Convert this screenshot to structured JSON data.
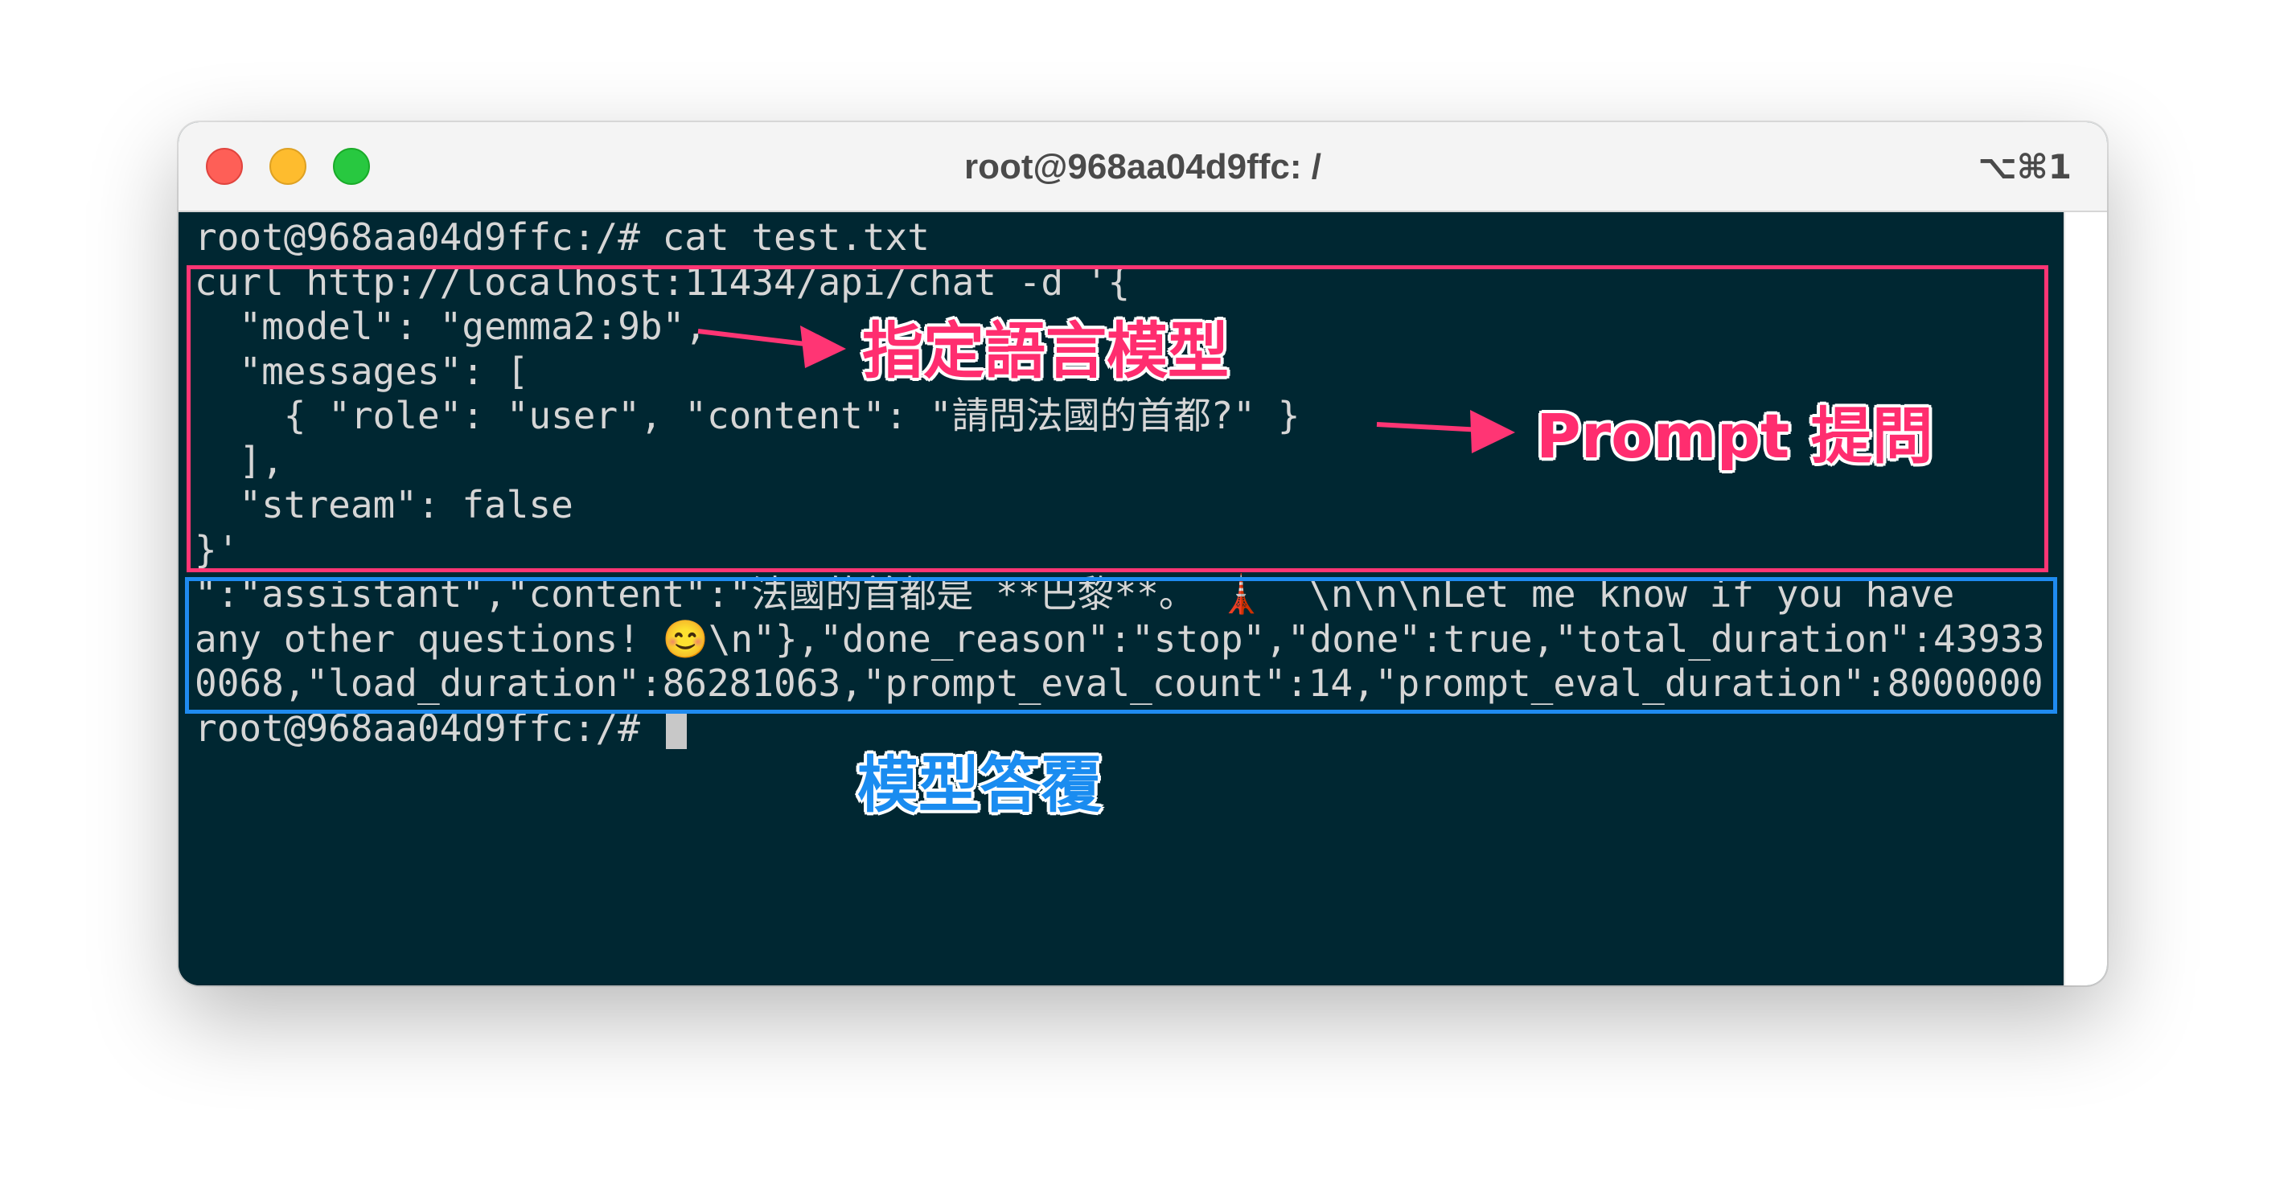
{
  "window": {
    "title": "root@968aa04d9ffc: /",
    "shortcut": "⌥⌘1"
  },
  "terminal": {
    "lines": [
      "root@968aa04d9ffc:/# cat test.txt",
      "curl http://localhost:11434/api/chat -d '{",
      "  \"model\": \"gemma2:9b\",",
      "  \"messages\": [",
      "    { \"role\": \"user\", \"content\": \"請問法國的首都?\" }",
      "  ],",
      "  \"stream\": false",
      "}'",
      "\":\"assistant\",\"content\":\"法國的首都是 **巴黎**。 🗼  \\n\\n\\nLet me know if you have",
      "any other questions! 😊\\n\"},\"done_reason\":\"stop\",\"done\":true,\"total_duration\":43933",
      "0068,\"load_duration\":86281063,\"prompt_eval_count\":14,\"prompt_eval_duration\":8000000"
    ],
    "prompt": "root@968aa04d9ffc:/# "
  },
  "annotations": {
    "model_label": "指定語言模型",
    "prompt_label": "Prompt 提問",
    "answer_label": "模型答覆",
    "pink_color": "#ff3574",
    "blue_color": "#1f8bf0"
  }
}
